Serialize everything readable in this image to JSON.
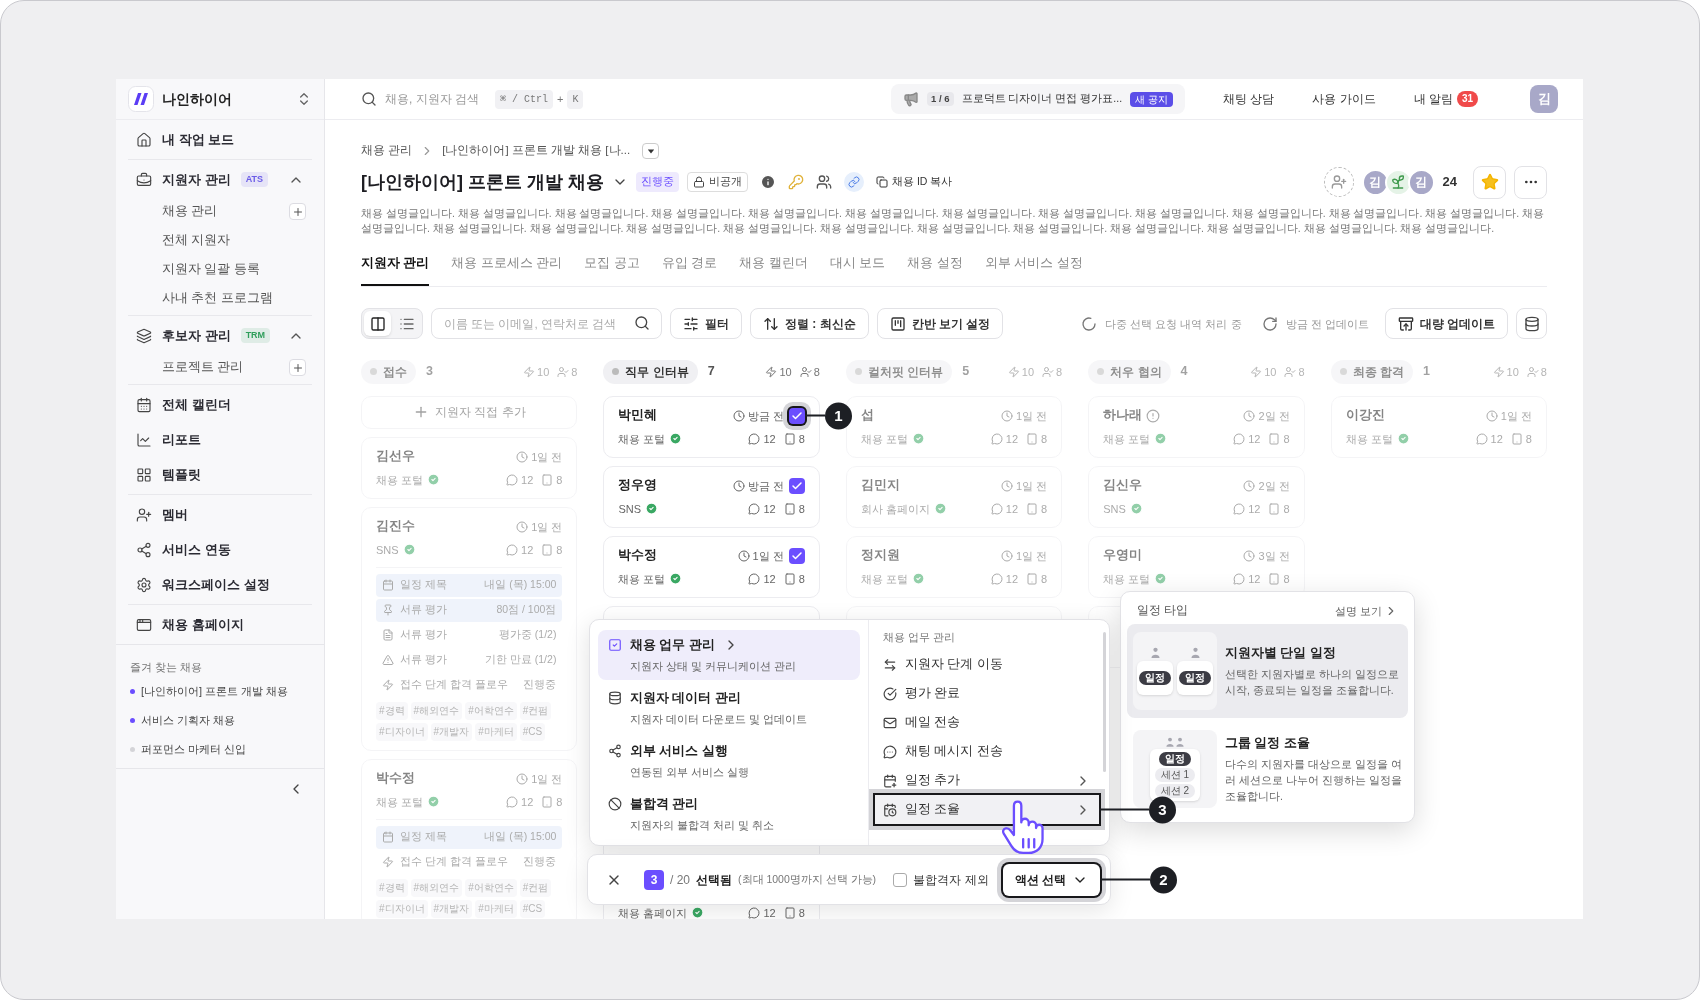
{
  "sidebar": {
    "workspace": "나인하이어",
    "nav_groups": [
      [
        {
          "label": "내 작업 보드"
        }
      ],
      [
        {
          "label": "지원자 관리",
          "badge": {
            "text": "ATS",
            "color": "#6b5ce7"
          },
          "expanded": true,
          "children": [
            {
              "label": "채용 관리",
              "add": true
            },
            {
              "label": "전체 지원자",
              "add": false
            },
            {
              "label": "지원자 일괄 등록",
              "add": false
            },
            {
              "label": "사내 추천 프로그램",
              "add": false
            }
          ]
        }
      ],
      [
        {
          "label": "후보자 관리",
          "badge": {
            "text": "TRM",
            "color": "#2f9e5b"
          },
          "expanded": true,
          "children": [
            {
              "label": "프로젝트 관리",
              "add": true
            }
          ]
        }
      ],
      [
        {
          "label": "전체 캘린더"
        },
        {
          "label": "리포트"
        },
        {
          "label": "템플릿"
        }
      ],
      [
        {
          "label": "멤버"
        },
        {
          "label": "서비스 연동"
        },
        {
          "label": "워크스페이스 설정"
        }
      ],
      [
        {
          "label": "채용 홈페이지"
        }
      ]
    ],
    "favorites": {
      "title": "즐겨 찾는 채용",
      "items": [
        {
          "label": "[나인하이어] 프론트 개발 채용",
          "color": "#6b4eff"
        },
        {
          "label": "서비스 기획자 채용",
          "color": "#6b4eff"
        },
        {
          "label": "퍼포먼스 마케터 신입",
          "color": "#d4d4d8"
        }
      ]
    }
  },
  "topbar": {
    "search_placeholder": "채용, 지원자 검색",
    "shortcut": {
      "keys": [
        "⌘ / Ctrl",
        "K"
      ],
      "joiner": "+"
    },
    "notice": {
      "counter": "1 / 6",
      "text": "프로덕트 디자이너 면접 평가표...",
      "badge": "새 공지"
    },
    "links": [
      "채팅 상담",
      "사용 가이드"
    ],
    "alerts": {
      "label": "내 알림",
      "count": "31"
    },
    "avatar": "김"
  },
  "header": {
    "breadcrumb": [
      "채용 관리",
      "[나인하이어] 프론트 개발 채용 [나..."
    ],
    "title": "[나인하이어] 프론트 개발 채용",
    "status": "진행중",
    "visibility": "비공개",
    "copy_label": "채용 ID 복사",
    "members": [
      {
        "kind": "initial",
        "text": "김"
      },
      {
        "kind": "sprout"
      },
      {
        "kind": "initial",
        "text": "김"
      }
    ],
    "member_count": "24",
    "starred": true,
    "description": "채용 설명글입니다. 채용 설명글입니다. 채용 설명글입니다. 채용 설명글입니다. 채용 설명글입니다. 채용 설명글입니다. 채용 설명글입니다. 채용 설명글입니다. 채용 설명글입니다. 채용 설명글입니다. 채용 설명글입니다. 채용 설명글입니다. 채용 설명글입니다. 채용 설명글입니다. 채용 설명글입니다. 채용 설명글입니다. 채용 설명글입니다. 채용 설명글입니다. 채용 설명글입니다. 채용 설명글입니다. 채용 설명글입니다. 채용 설명글입니다. 채용 설명글입니다. 채용 설명글입니다."
  },
  "tabs": [
    {
      "label": "지원자 관리",
      "selected": true
    },
    {
      "label": "채용 프로세스 관리",
      "selected": false
    },
    {
      "label": "모집 공고",
      "selected": false
    },
    {
      "label": "유입 경로",
      "selected": false
    },
    {
      "label": "채용 캘린더",
      "selected": false
    },
    {
      "label": "대시 보드",
      "selected": false
    },
    {
      "label": "채용 설정",
      "selected": false
    },
    {
      "label": "외부 서비스 설정",
      "selected": false
    }
  ],
  "toolbar": {
    "view_modes": [
      {
        "kind": "kanban",
        "selected": true
      },
      {
        "kind": "list",
        "selected": false
      }
    ],
    "search_placeholder": "이름 또는 이메일, 연락처로 검색",
    "filter_label": "필터",
    "sort_label": "정렬 : 최신순",
    "kanban_settings_label": "칸반 보기 설정",
    "processing_status": "다중 선택 요청 내역 처리 중",
    "updated_status": "방금 전 업데이트",
    "bulk_update_label": "대량 업데이트"
  },
  "columns": [
    {
      "stage": "접수",
      "count": "3",
      "actions": "10",
      "people": "8",
      "dimmed": true,
      "add_label": "지원자 직접 추가",
      "cards": [
        {
          "kind": "applicant",
          "name": "김선우",
          "time": "1일 전",
          "source": "채용 포털",
          "comments": "12",
          "files": "8",
          "flagged": false
        },
        {
          "kind": "applicant",
          "name": "김진수",
          "time": "1일 전",
          "source": "SNS",
          "comments": "12",
          "files": "8",
          "flagged": false,
          "details": [
            {
              "kind": "schedule",
              "label": "일정 제목",
              "value": "내일 (목) 15:00",
              "shaded": true
            },
            {
              "kind": "review",
              "label": "서류 평가",
              "value": "80점 / 100점",
              "shaded": true
            },
            {
              "kind": "pending",
              "label": "서류 평가",
              "value": "평가중 (1/2)",
              "shaded": false
            },
            {
              "kind": "expired",
              "label": "서류 평가",
              "value": "기한 만료 (1/2)",
              "shaded": false
            },
            {
              "kind": "flow",
              "label": "접수 단계 합격 플로우",
              "value": "진행중",
              "shaded": false
            }
          ],
          "tags": [
            "#경력",
            "#해외연수",
            "#어학연수",
            "#컨펌",
            "#디자이너",
            "#개발자",
            "#마케터",
            "#CS"
          ]
        },
        {
          "kind": "applicant",
          "name": "박수정",
          "time": "1일 전",
          "source": "채용 포털",
          "comments": "12",
          "files": "8",
          "flagged": false,
          "details": [
            {
              "kind": "schedule",
              "label": "일정 제목",
              "value": "내일 (목) 15:00",
              "shaded": true
            },
            {
              "kind": "flow",
              "label": "접수 단계 합격 플로우",
              "value": "진행중",
              "shaded": false
            }
          ],
          "tags": [
            "#경력",
            "#해외연수",
            "#어학연수",
            "#컨펌",
            "#디자이너",
            "#개발자",
            "#마케터",
            "#CS"
          ]
        }
      ]
    },
    {
      "stage": "직무 인터뷰",
      "count": "7",
      "actions": "10",
      "people": "8",
      "dimmed": false,
      "cards": [
        {
          "kind": "applicant",
          "name": "박민혜",
          "time": "방금 전",
          "source": "채용 포털",
          "comments": "12",
          "files": "8",
          "flagged": false,
          "checked": true,
          "callout": "1"
        },
        {
          "kind": "applicant",
          "name": "정우영",
          "time": "방금 전",
          "source": "SNS",
          "comments": "12",
          "files": "8",
          "flagged": false,
          "checked": true
        },
        {
          "kind": "applicant",
          "name": "박수정",
          "time": "1일 전",
          "source": "채용 포털",
          "comments": "12",
          "files": "8",
          "flagged": false,
          "checked": true
        },
        {
          "kind": "hidden"
        },
        {
          "kind": "partial",
          "source": "채용 홈페이지",
          "comments": "12",
          "files": "8"
        }
      ]
    },
    {
      "stage": "컬처핏 인터뷰",
      "count": "5",
      "actions": "10",
      "people": "8",
      "dimmed": true,
      "cards": [
        {
          "kind": "applicant",
          "name": "섭",
          "time": "1일 전",
          "source": "채용 포털",
          "comments": "12",
          "files": "8",
          "flagged": false
        },
        {
          "kind": "applicant",
          "name": "김민지",
          "time": "1일 전",
          "source": "회사 홈페이지",
          "comments": "12",
          "files": "8",
          "flagged": false
        },
        {
          "kind": "applicant",
          "name": "정지원",
          "time": "1일 전",
          "source": "채용 포털",
          "comments": "12",
          "files": "8",
          "flagged": false
        },
        {
          "kind": "hidden"
        }
      ]
    },
    {
      "stage": "처우 협의",
      "count": "4",
      "actions": "10",
      "people": "8",
      "dimmed": true,
      "cards": [
        {
          "kind": "applicant",
          "name": "하나래",
          "time": "2일 전",
          "source": "채용 포털",
          "comments": "12",
          "files": "8",
          "flagged": true
        },
        {
          "kind": "applicant",
          "name": "김신우",
          "time": "2일 전",
          "source": "SNS",
          "comments": "12",
          "files": "8",
          "flagged": false
        },
        {
          "kind": "applicant",
          "name": "우영미",
          "time": "3일 전",
          "source": "채용 포털",
          "comments": "12",
          "files": "8",
          "flagged": false
        },
        {
          "kind": "hidden"
        }
      ]
    },
    {
      "stage": "최종 합격",
      "count": "1",
      "actions": "10",
      "people": "8",
      "dimmed": true,
      "cards": [
        {
          "kind": "applicant",
          "name": "이강진",
          "time": "1일 전",
          "source": "채용 포털",
          "comments": "12",
          "files": "8",
          "flagged": false
        }
      ]
    }
  ],
  "action_menu": {
    "categories": [
      {
        "title": "채용 업무 관리",
        "desc": "지원자 상태 및 커뮤니케이션 관리",
        "selected": true
      },
      {
        "title": "지원자 데이터 관리",
        "desc": "지원자 데이터 다운로드 및 업데이트",
        "selected": false
      },
      {
        "title": "외부 서비스 실행",
        "desc": "연동된 외부 서비스 실행",
        "selected": false
      },
      {
        "title": "불합격 관리",
        "desc": "지원자의 불합격 처리 및 취소",
        "selected": false
      }
    ],
    "submenu": {
      "title": "채용 업무 관리",
      "items": [
        {
          "label": "지원자 단계 이동",
          "has_submenu": false,
          "selected": false
        },
        {
          "label": "평가 완료",
          "has_submenu": false,
          "selected": false
        },
        {
          "label": "메일 전송",
          "has_submenu": false,
          "selected": false
        },
        {
          "label": "채팅 메시지 전송",
          "has_submenu": false,
          "selected": false
        },
        {
          "label": "일정 추가",
          "has_submenu": true,
          "selected": false
        },
        {
          "label": "일정 조율",
          "has_submenu": true,
          "selected": true,
          "callout": "3"
        }
      ]
    }
  },
  "selection_bar": {
    "count": "3",
    "total": "/ 20",
    "label": "선택됨",
    "hint": "(최대 1000명까지 선택 가능)",
    "exclude_label": "불합격자 제외",
    "exclude_checked": false,
    "action_label": "액션 선택",
    "callout": "2"
  },
  "schedule_popup": {
    "title": "일정 타입",
    "help": "설명 보기",
    "options": [
      {
        "kind": "single",
        "title": "지원자별 단일 일정",
        "desc": "선택한 지원자별로 하나의 일정으로 시작, 종료되는 일정을 조율합니다.",
        "selected": true,
        "chips": [
          "일정",
          "일정"
        ]
      },
      {
        "kind": "group",
        "title": "그룹 일정 조율",
        "desc": "다수의 지원자를 대상으로 일정을 여러 세션으로 나누어 진행하는 일정을 조율합니다.",
        "selected": false,
        "chips": [
          "일정",
          "세션 1",
          "세션 2"
        ]
      }
    ]
  }
}
